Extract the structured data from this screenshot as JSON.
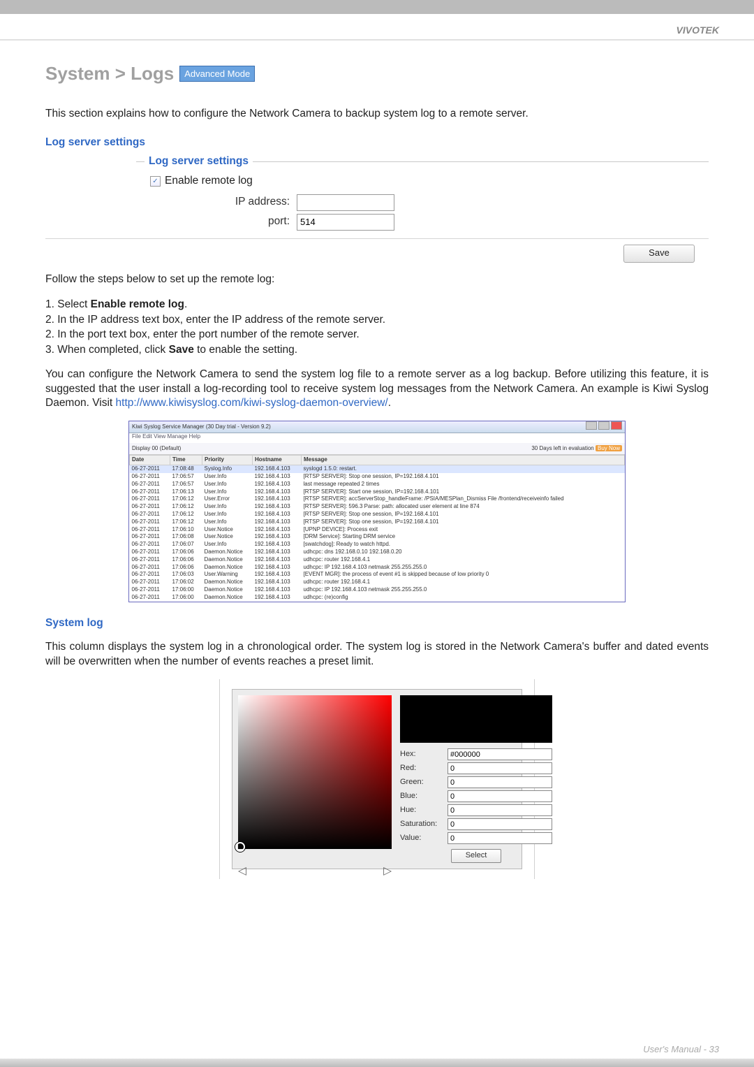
{
  "brand": "VIVOTEK",
  "heading": "System > Logs",
  "modeBadge": "Advanced Mode",
  "intro": "This section explains how to configure the Network Camera to backup system log to a remote server.",
  "section1": {
    "title": "Log server settings",
    "legend": "Log server settings",
    "enableRemoteLog": "Enable remote log",
    "ipLabel": "IP address:",
    "ipValue": "",
    "portLabel": "port:",
    "portValue": "514",
    "saveBtn": "Save"
  },
  "stepsIntro": "Follow the steps below to set up the remote log:",
  "steps": [
    "1. Select ",
    "Enable remote log",
    ".",
    "2. In the IP address text box, enter the IP address of the remote server.",
    "2. In the port text box, enter the port number of the remote server.",
    "3. When completed, click ",
    "Save",
    " to enable the setting."
  ],
  "para2a": "You can configure the Network Camera to send the system log file to a remote server as a log backup. Before utilizing this feature, it is suggested that the user install a log-recording tool to receive system log messages from the Network Camera. An example is Kiwi Syslog Daemon. Visit ",
  "para2link": "http://www.kiwisyslog.com/kiwi-syslog-daemon-overview/",
  "para2b": ".",
  "syslog": {
    "title": "Kiwi Syslog Service Manager (30 Day trial - Version 9.2)",
    "menu": "File  Edit  View  Manage  Help",
    "toolbarLeft": "Display 00 (Default)",
    "toolbarRight": "30 Days left in evaluation",
    "buyNow": "Buy Now",
    "cols": [
      "Date",
      "Time",
      "Priority",
      "Hostname",
      "Message"
    ],
    "rows": [
      {
        "date": "06-27-2011",
        "time": "17:08:48",
        "pri": "Syslog.Info",
        "host": "192.168.4.103",
        "msg": "syslogd 1.5.0: restart.",
        "sel": true
      },
      {
        "date": "06-27-2011",
        "time": "17:06:57",
        "pri": "User.Info",
        "host": "192.168.4.103",
        "msg": "[RTSP SERVER]: Stop one session, IP=192.168.4.101"
      },
      {
        "date": "06-27-2011",
        "time": "17:06:57",
        "pri": "User.Info",
        "host": "192.168.4.103",
        "msg": "last message repeated 2 times"
      },
      {
        "date": "06-27-2011",
        "time": "17:06:13",
        "pri": "User.Info",
        "host": "192.168.4.103",
        "msg": "[RTSP SERVER]: Start one session, IP=192.168.4.101"
      },
      {
        "date": "06-27-2011",
        "time": "17:06:12",
        "pri": "User.Error",
        "host": "192.168.4.103",
        "msg": "[RTSP SERVER]: accServerStop_handleFrame: /PSIA/MESPlan_Dismiss File /frontend/receiveinfo failed"
      },
      {
        "date": "06-27-2011",
        "time": "17:06:12",
        "pri": "User.Info",
        "host": "192.168.4.103",
        "msg": "[RTSP SERVER]: 596.3 Parse: path: allocated user element at line 874"
      },
      {
        "date": "06-27-2011",
        "time": "17:06:12",
        "pri": "User.Info",
        "host": "192.168.4.103",
        "msg": "[RTSP SERVER]: Stop one session, IP=192.168.4.101"
      },
      {
        "date": "06-27-2011",
        "time": "17:06:12",
        "pri": "User.Info",
        "host": "192.168.4.103",
        "msg": "[RTSP SERVER]: Stop one session, IP=192.168.4.101"
      },
      {
        "date": "06-27-2011",
        "time": "17:06:10",
        "pri": "User.Notice",
        "host": "192.168.4.103",
        "msg": "[UPNP DEVICE]: Process exit"
      },
      {
        "date": "06-27-2011",
        "time": "17:06:08",
        "pri": "User.Notice",
        "host": "192.168.4.103",
        "msg": "[DRM Service]: Starting DRM service"
      },
      {
        "date": "06-27-2011",
        "time": "17:06:07",
        "pri": "User.Info",
        "host": "192.168.4.103",
        "msg": "[swatchdog]: Ready to watch httpd."
      },
      {
        "date": "06-27-2011",
        "time": "17:06:06",
        "pri": "Daemon.Notice",
        "host": "192.168.4.103",
        "msg": "udhcpc: dns 192.168.0.10 192.168.0.20"
      },
      {
        "date": "06-27-2011",
        "time": "17:06:06",
        "pri": "Daemon.Notice",
        "host": "192.168.4.103",
        "msg": "udhcpc: router 192.168.4.1"
      },
      {
        "date": "06-27-2011",
        "time": "17:06:06",
        "pri": "Daemon.Notice",
        "host": "192.168.4.103",
        "msg": "udhcpc: IP 192.168.4.103 netmask 255.255.255.0"
      },
      {
        "date": "06-27-2011",
        "time": "17:06:03",
        "pri": "User.Warning",
        "host": "192.168.4.103",
        "msg": "[EVENT MGR]: the process of event #1 is skipped because of low priority 0"
      },
      {
        "date": "06-27-2011",
        "time": "17:06:02",
        "pri": "Daemon.Notice",
        "host": "192.168.4.103",
        "msg": "udhcpc: router 192.168.4.1"
      },
      {
        "date": "06-27-2011",
        "time": "17:06:00",
        "pri": "Daemon.Notice",
        "host": "192.168.4.103",
        "msg": "udhcpc: IP 192.168.4.103 netmask 255.255.255.0"
      },
      {
        "date": "06-27-2011",
        "time": "17:06:00",
        "pri": "Daemon.Notice",
        "host": "192.168.4.103",
        "msg": "udhcpc: (re)config"
      }
    ]
  },
  "section2": {
    "title": "System log",
    "para": "This column displays the system log in a chronological order. The system log is stored in the Network Camera's buffer and dated events will be overwritten when the number of events reaches a preset limit."
  },
  "colorpicker": {
    "hexLabel": "Hex:",
    "hexValue": "#000000",
    "redLabel": "Red:",
    "redValue": "0",
    "greenLabel": "Green:",
    "greenValue": "0",
    "blueLabel": "Blue:",
    "blueValue": "0",
    "hueLabel": "Hue:",
    "hueValue": "0",
    "satLabel": "Saturation:",
    "satValue": "0",
    "valLabel": "Value:",
    "valValue": "0",
    "selectBtn": "Select"
  },
  "footer": "User's Manual - 33"
}
